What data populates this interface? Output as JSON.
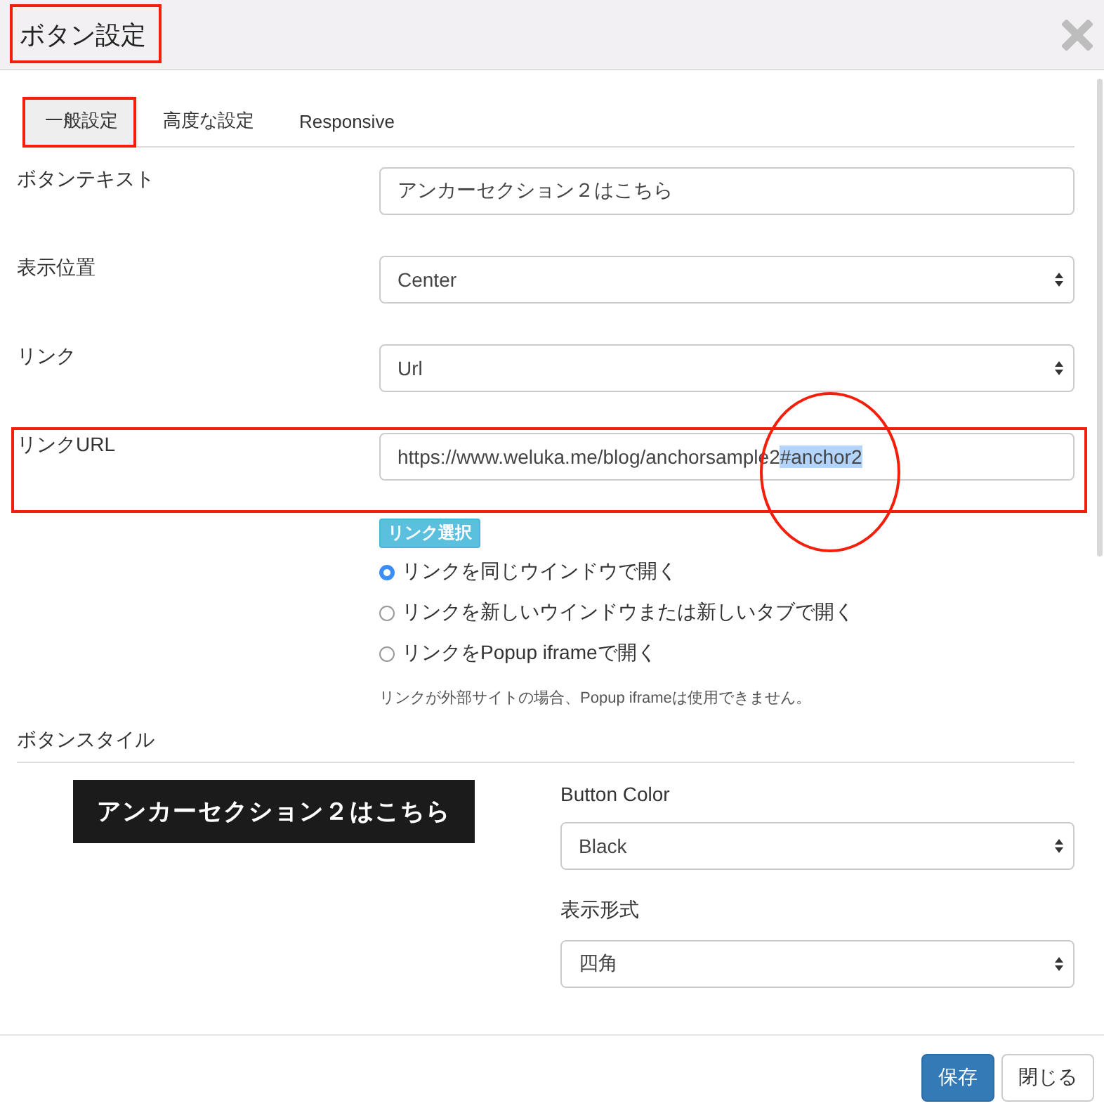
{
  "dialog": {
    "title": "ボタン設定"
  },
  "tabs": [
    {
      "label": "一般設定",
      "selected": true
    },
    {
      "label": "高度な設定",
      "selected": false
    },
    {
      "label": "Responsive",
      "selected": false
    }
  ],
  "fields": [
    {
      "kind": "text",
      "label": "ボタンテキスト",
      "value": "アンカーセクション２はこちら"
    },
    {
      "kind": "select",
      "label": "表示位置",
      "value": "Center"
    },
    {
      "kind": "select",
      "label": "リンク",
      "value": "Url"
    }
  ],
  "link_url": {
    "label": "リンクURL",
    "value": [
      {
        "text": "https://www.weluka.me/blog/anchorsample2",
        "selected": false
      },
      {
        "text": "#anchor2",
        "selected": true
      }
    ],
    "pick_button": "リンク選択",
    "options": [
      {
        "label": "リンクを同じウインドウで開く",
        "selected": true
      },
      {
        "label": "リンクを新しいウインドウまたは新しいタブで開く",
        "selected": false
      },
      {
        "label": "リンクをPopup iframeで開く",
        "selected": false
      }
    ],
    "note": "リンクが外部サイトの場合、Popup iframeは使用できません。"
  },
  "button_style": {
    "heading": "ボタンスタイル",
    "preview": "アンカーセクション２はこちら",
    "fields": [
      {
        "label": "Button Color",
        "value": "Black"
      },
      {
        "label": "表示形式",
        "value": "四角"
      }
    ]
  },
  "footer": {
    "save": "保存",
    "close": "閉じる"
  }
}
